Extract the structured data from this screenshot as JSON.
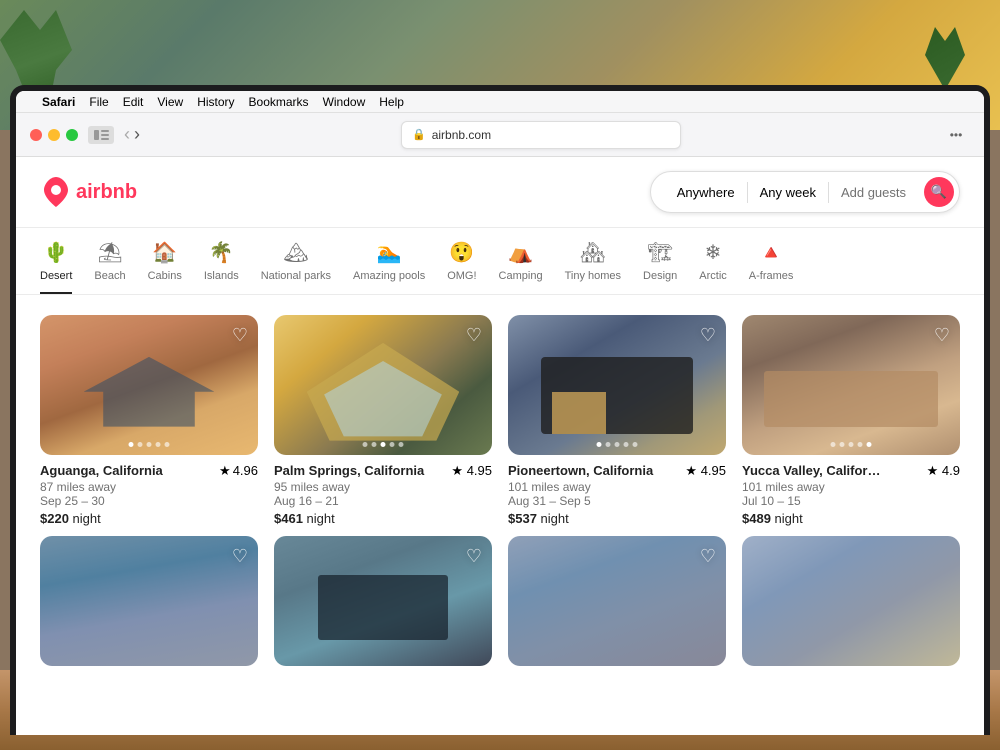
{
  "background": {
    "color": "#8a7560"
  },
  "menubar": {
    "items": [
      "Safari",
      "File",
      "Edit",
      "View",
      "History",
      "Bookmarks",
      "Window",
      "Help"
    ]
  },
  "browser": {
    "back_btn": "‹",
    "forward_btn": "›",
    "address": "airbnb.com",
    "shield_icon": "🛡",
    "dots": "•••"
  },
  "header": {
    "logo_text": "airbnb",
    "search_anywhere": "Anywhere",
    "search_week": "Any week",
    "search_guests": "Add guests"
  },
  "categories": [
    {
      "id": "desert",
      "label": "Desert",
      "icon": "🌵",
      "active": true
    },
    {
      "id": "beach",
      "label": "Beach",
      "icon": "⛱",
      "active": false
    },
    {
      "id": "cabins",
      "label": "Cabins",
      "icon": "🏠",
      "active": false
    },
    {
      "id": "islands",
      "label": "Islands",
      "icon": "🌴",
      "active": false
    },
    {
      "id": "national-parks",
      "label": "National parks",
      "icon": "🏔",
      "active": false
    },
    {
      "id": "amazing-pools",
      "label": "Amazing pools",
      "icon": "🏊",
      "active": false
    },
    {
      "id": "omg",
      "label": "OMG!",
      "icon": "😲",
      "active": false
    },
    {
      "id": "camping",
      "label": "Camping",
      "icon": "⛺",
      "active": false
    },
    {
      "id": "tiny-homes",
      "label": "Tiny homes",
      "icon": "🏘",
      "active": false
    },
    {
      "id": "design",
      "label": "Design",
      "icon": "🏗",
      "active": false
    },
    {
      "id": "arctic",
      "label": "Arctic",
      "icon": "❄",
      "active": false
    },
    {
      "id": "a-frames",
      "label": "A-frames",
      "icon": "🔺",
      "active": false
    }
  ],
  "properties": [
    {
      "id": "prop1",
      "location": "Aguanga, California",
      "rating": "4.96",
      "distance": "87 miles away",
      "dates": "Sep 25 – 30",
      "price": "$220",
      "img_class": "img-desert1",
      "dots": 5,
      "active_dot": 1
    },
    {
      "id": "prop2",
      "location": "Palm Springs, California",
      "rating": "4.95",
      "distance": "95 miles away",
      "dates": "Aug 16 – 21",
      "price": "$461",
      "img_class": "img-desert2",
      "dots": 5,
      "active_dot": 3
    },
    {
      "id": "prop3",
      "location": "Pioneertown, California",
      "rating": "4.95",
      "distance": "101 miles away",
      "dates": "Aug 31 – Sep 5",
      "price": "$537",
      "img_class": "img-desert3",
      "dots": 5,
      "active_dot": 1
    },
    {
      "id": "prop4",
      "location": "Yucca Valley, Califor…",
      "rating": "4.9",
      "distance": "101 miles away",
      "dates": "Jul 10 – 15",
      "price": "$489",
      "img_class": "img-desert4",
      "dots": 5,
      "active_dot": 5
    }
  ],
  "properties_row2": [
    {
      "id": "prop5",
      "img_class": "img-desert5"
    },
    {
      "id": "prop6",
      "img_class": "img-desert6"
    },
    {
      "id": "prop7",
      "img_class": "img-desert7"
    },
    {
      "id": "prop8",
      "img_class": "img-desert5"
    }
  ],
  "price_suffix": "night"
}
